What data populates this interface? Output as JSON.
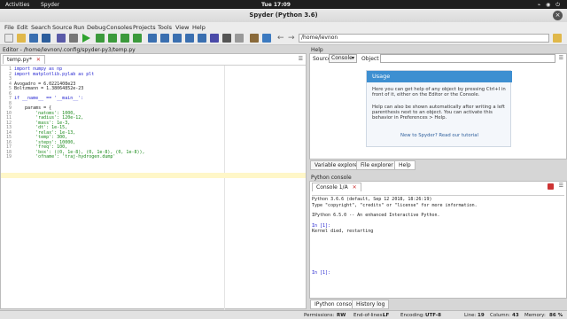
{
  "topbar": {
    "activities": "Activities",
    "app": "Spyder",
    "clock": "Tue 17:09",
    "sys_icons": "⌁ ◉ ⏻"
  },
  "window": {
    "title": "Spyder (Python 3.6)",
    "close": "×"
  },
  "menu": [
    "File",
    "Edit",
    "Search",
    "Source",
    "Run",
    "Debug",
    "Consoles",
    "Projects",
    "Tools",
    "View",
    "Help"
  ],
  "toolbar": {
    "path": "/home/levnon"
  },
  "editor": {
    "title": "Editor - /home/levnon/.config/spyder-py3/temp.py",
    "tab": "temp.py*",
    "lines": [
      {
        "n": "1",
        "t": "import numpy as np"
      },
      {
        "n": "2",
        "t": "import matplotlib.pylab as plt"
      },
      {
        "n": "3",
        "t": ""
      },
      {
        "n": "4",
        "t": "Avogadro = 6.0221408e23"
      },
      {
        "n": "5",
        "t": "Boltzmann = 1.38064852e-23"
      },
      {
        "n": "6",
        "t": ""
      },
      {
        "n": "7",
        "t": "if __name__ == '__main__':"
      },
      {
        "n": "8",
        "t": ""
      },
      {
        "n": "9",
        "t": "    params = {"
      },
      {
        "n": "10",
        "t": "        'natoms': 1000,"
      },
      {
        "n": "11",
        "t": "        'radius': 120e-12,"
      },
      {
        "n": "12",
        "t": "        'mass': 1e-3,"
      },
      {
        "n": "13",
        "t": "        'dt': 1e-15,"
      },
      {
        "n": "14",
        "t": "        'relax': 1e-13,"
      },
      {
        "n": "15",
        "t": "        'temp': 300,"
      },
      {
        "n": "16",
        "t": "        'steps': 10000,"
      },
      {
        "n": "17",
        "t": "        'freq': 100,"
      },
      {
        "n": "18",
        "t": "        'box': ((0, 1e-8), (0, 1e-8), (0, 1e-8)),"
      },
      {
        "n": "19",
        "t": "        'ofname': 'traj-hydrogen.dump'"
      }
    ]
  },
  "help": {
    "title": "Help",
    "source_label": "Source",
    "source_value": "Console",
    "object_label": "Object",
    "usage_title": "Usage",
    "usage_p1": "Here you can get help of any object by pressing Ctrl+I in front of it, either on the Editor or the Console.",
    "usage_p2": "Help can also be shown automatically after writing a left parenthesis next to an object. You can activate this behavior in Preferences > Help.",
    "usage_p3": "New to Spyder? Read our tutorial",
    "tabs": [
      "Variable explorer",
      "File explorer",
      "Help"
    ]
  },
  "console": {
    "title": "Python console",
    "tab": "Console 1/A",
    "lines": [
      "Python 3.6.6 (default, Sep 12 2018, 18:26:19)",
      "Type \"copyright\", \"credits\" or \"license\" for more information.",
      "",
      "IPython 6.5.0 -- An enhanced Interactive Python.",
      "",
      "In [1]:",
      "Kernel died, restarting"
    ],
    "prompt": "In [1]:",
    "bottom_tabs": [
      "IPython console",
      "History log"
    ]
  },
  "status": {
    "permissions_label": "Permissions:",
    "permissions": "RW",
    "eol_label": "End-of-lines:",
    "eol": "LF",
    "encoding_label": "Encoding:",
    "encoding": "UTF-8",
    "line_label": "Line:",
    "line": "19",
    "column_label": "Column:",
    "column": "43",
    "memory_label": "Memory:",
    "memory": "86 %"
  }
}
